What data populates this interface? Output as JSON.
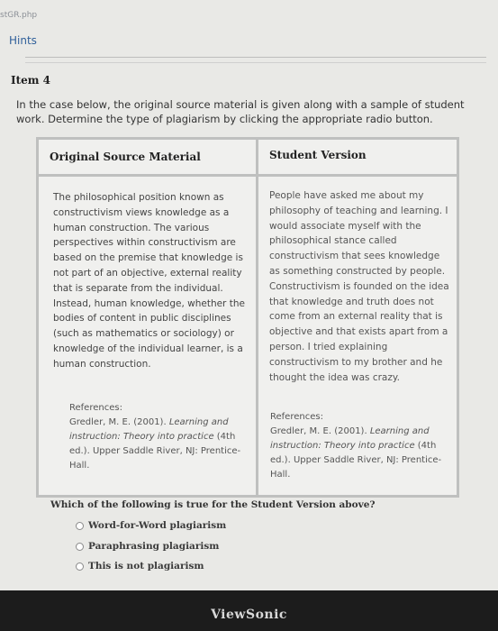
{
  "page": {
    "url_fragment": "stGR.php",
    "hints_label": "Hints",
    "item_title": "Item 4",
    "instructions": "In the case below, the original source material is given along with a sample of student work. Determine the type of plagiarism by clicking the appropriate radio button."
  },
  "table": {
    "headers": [
      "Original Source Material",
      "Student Version"
    ],
    "original_text": "The philosophical position known as constructivism views knowledge as a human construction. The various perspectives within constructivism are based on the premise that knowledge is not part of an objective, external reality that is separate from the individual. Instead, human knowledge, whether the bodies of content in public disciplines (such as mathematics or sociology) or knowledge of the individual learner, is a human construction.",
    "student_text": "People have asked me about my philosophy of teaching and learning. I would associate myself with the philosophical stance called constructivism that sees knowledge as something constructed by people. Constructivism is founded on the idea that knowledge and truth does not come from an external reality that is objective and that exists apart from a person. I tried explaining constructivism to my brother and he thought the idea was crazy.",
    "references_label": "References:",
    "ref_author": "Gredler, M. E. (2001).",
    "ref_title": "Learning and instruction: Theory into practice",
    "ref_rest": "(4th ed.). Upper Saddle River, NJ: Prentice-Hall."
  },
  "question": {
    "text": "Which of the following is true for the Student Version above?",
    "options": [
      "Word-for-Word plagiarism",
      "Paraphrasing plagiarism",
      "This is not plagiarism"
    ]
  },
  "monitor": {
    "brand": "ViewSonic"
  }
}
